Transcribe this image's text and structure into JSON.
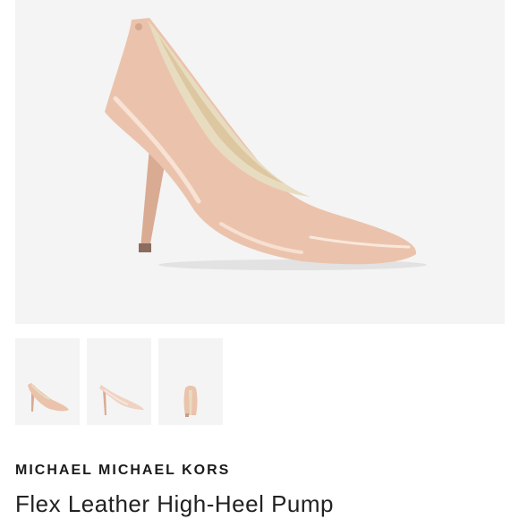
{
  "product": {
    "brand": "MICHAEL MICHAEL KORS",
    "name": "Flex Leather High-Heel Pump"
  },
  "images": {
    "main": {
      "icon": "shoe-side-view",
      "color": "#ebc3ac"
    },
    "thumbnails": [
      {
        "icon": "shoe-side-view-thumbnail"
      },
      {
        "icon": "shoe-angle-view-thumbnail"
      },
      {
        "icon": "shoe-back-view-thumbnail"
      }
    ]
  },
  "colors": {
    "shoe": "#ebc3ac",
    "insole": "#e8dcc0",
    "background": "#f4f4f4"
  }
}
